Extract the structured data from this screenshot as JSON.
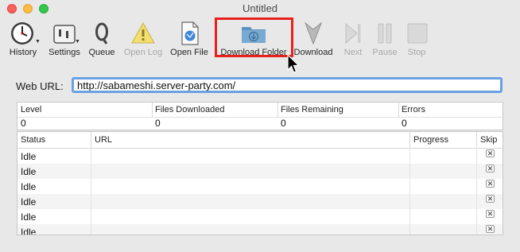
{
  "window": {
    "title": "Untitled"
  },
  "toolbar": {
    "history": "History",
    "settings": "Settings",
    "queue": "Queue",
    "open_log": "Open Log",
    "open_file": "Open File",
    "download_folder": "Download Folder",
    "download": "Download",
    "next": "Next",
    "pause": "Pause",
    "stop": "Stop"
  },
  "url": {
    "label": "Web URL:",
    "value": "http://sabameshi.server-party.com/"
  },
  "stats": {
    "headers": [
      "Level",
      "Files Downloaded",
      "Files Remaining",
      "Errors"
    ],
    "values": [
      "0",
      "0",
      "0",
      "0"
    ]
  },
  "table": {
    "headers": [
      "Status",
      "URL",
      "Progress",
      "Skip"
    ],
    "skip_glyph": "✕",
    "rows": [
      {
        "status": "Idle"
      },
      {
        "status": "Idle"
      },
      {
        "status": "Idle"
      },
      {
        "status": "Idle"
      },
      {
        "status": "Idle"
      },
      {
        "status": "Idle"
      }
    ]
  },
  "colors": {
    "highlight": "#e8201c",
    "focus_ring": "#6aa0e4"
  }
}
